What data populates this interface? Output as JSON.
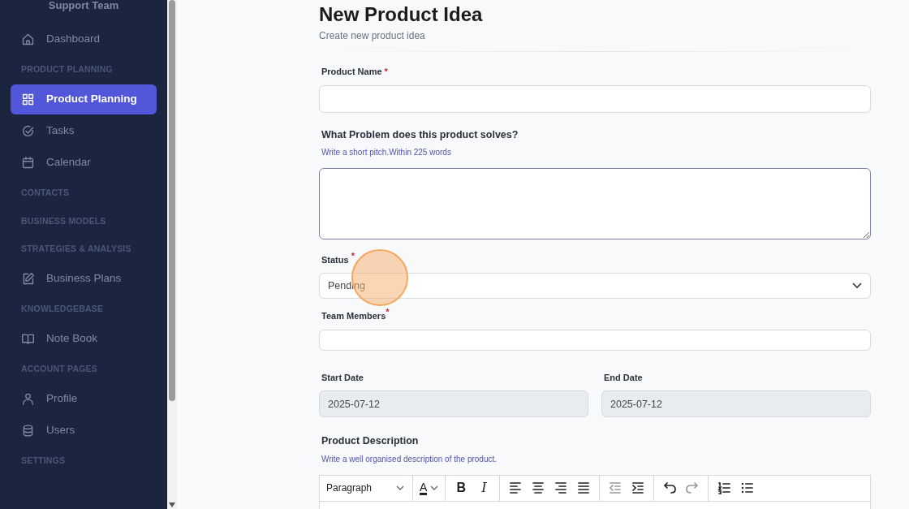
{
  "sidebar": {
    "team": "Support Team",
    "items": [
      {
        "kind": "link",
        "label": "Dashboard",
        "selected": false
      },
      {
        "kind": "header",
        "label": "PRODUCT PLANNING"
      },
      {
        "kind": "link",
        "label": "Product Planning",
        "selected": true
      },
      {
        "kind": "link",
        "label": "Tasks",
        "selected": false
      },
      {
        "kind": "link",
        "label": "Calendar",
        "selected": false
      },
      {
        "kind": "header",
        "label": "CONTACTS"
      },
      {
        "kind": "header",
        "label": "BUSINESS MODELS"
      },
      {
        "kind": "header",
        "label": "STRATEGIES & ANALYSIS"
      },
      {
        "kind": "link",
        "label": "Business Plans",
        "selected": false
      },
      {
        "kind": "header",
        "label": "KNOWLEDGEBASE"
      },
      {
        "kind": "link",
        "label": "Note Book",
        "selected": false
      },
      {
        "kind": "header",
        "label": "ACCOUNT PAGES"
      },
      {
        "kind": "link",
        "label": "Profile",
        "selected": false
      },
      {
        "kind": "link",
        "label": "Users",
        "selected": false
      },
      {
        "kind": "header",
        "label": "SETTINGS"
      }
    ]
  },
  "page": {
    "title": "New Product Idea",
    "subtitle": "Create new product idea"
  },
  "form": {
    "product_name": {
      "label": "Product Name",
      "mark": "*"
    },
    "problem": {
      "label": "What Problem does this product solves?",
      "hint": "Write a short pitch.Within 225 words"
    },
    "status": {
      "label": "Status",
      "mark": "*",
      "value": "Pending"
    },
    "team_members": {
      "label": "Team Members",
      "mark": "*"
    },
    "start_date": {
      "label": "Start Date",
      "value": "2025-07-12",
      "disabled": true
    },
    "end_date": {
      "label": "End Date",
      "value": "2025-07-12",
      "disabled": true
    },
    "description": {
      "label": "Product Description",
      "hint": "Write a well organised description of the product.",
      "toolbar": [
        [
          {
            "kind": "select",
            "label": "Paragraph"
          }
        ],
        [
          {
            "kind": "color",
            "label": "A"
          }
        ],
        [
          {
            "kind": "bold",
            "label": "B"
          },
          {
            "kind": "italic",
            "label": "I"
          }
        ],
        [
          {
            "kind": "align-left"
          },
          {
            "kind": "align-center"
          },
          {
            "kind": "align-right"
          },
          {
            "kind": "justify"
          }
        ],
        [
          {
            "kind": "outdent",
            "disabled": true
          },
          {
            "kind": "indent",
            "disabled": false
          }
        ],
        [
          {
            "kind": "undo",
            "disabled": false
          },
          {
            "kind": "redo",
            "disabled": true
          }
        ],
        [
          {
            "kind": "numbered-list"
          },
          {
            "kind": "bulleted-list"
          }
        ]
      ]
    }
  }
}
